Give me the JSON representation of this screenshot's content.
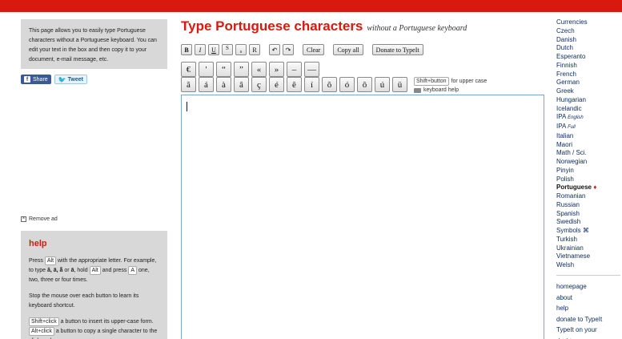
{
  "intro": {
    "text": "This page allows you to easily type Portuguese characters without a Portuguese keyboard. You can edit your text in the box and then copy it to your document, e-mail message, etc."
  },
  "share": {
    "facebook_label": "Share",
    "twitter_label": "Tweet"
  },
  "remove_ad": "Remove ad",
  "help": {
    "heading": "help",
    "p1_a": "Press",
    "p1_alt": "Alt",
    "p1_b": "with the appropriate letter. For example, to type",
    "p1_chars": "ǎ, ā, ā̃",
    "p1_or": "or",
    "p1_char_last": "ā",
    "p1_c": ", hold",
    "p1_alt2": "Alt",
    "p1_d": "and press",
    "p1_a_key": "A",
    "p1_e": "one, two, three or four times.",
    "p2": "Stop the mouse over each button to learn its keyboard shortcut.",
    "p3_shift": "Shift+click",
    "p3_a": "a button to insert its upper-case form.",
    "p3_alt": "Alt+click",
    "p3_b": "a button to copy a single character to the clipboard."
  },
  "header": {
    "title": "Type Portuguese characters",
    "subtitle": "without a Portuguese keyboard"
  },
  "format_buttons": [
    "B",
    "I",
    "U",
    "S",
    "s",
    "R"
  ],
  "undo_redo": [
    "↶",
    "↷"
  ],
  "actions": {
    "clear": "Clear",
    "copy_all": "Copy all",
    "donate": "Donate to TypeIt"
  },
  "symbols": [
    "€",
    "'",
    "“",
    "”",
    "«",
    "»",
    "–",
    "—"
  ],
  "characters": [
    "ã",
    "á",
    "à",
    "â",
    "ç",
    "é",
    "ê",
    "í",
    "õ",
    "ó",
    "ô",
    "ú",
    "ü"
  ],
  "shift_info": {
    "key": "Shift+button",
    "text": "for upper case",
    "kb_help": "keyboard help"
  },
  "editor": {
    "value": ""
  },
  "languages": [
    "Currencies",
    "Czech",
    "Danish",
    "Dutch",
    "Esperanto",
    "Finnish",
    "French",
    "German",
    "Greek",
    "Hungarian",
    "Icelandic",
    "IPA",
    "IPA",
    "Italian",
    "Maori",
    "Math / Sci.",
    "Norwegian",
    "Pinyin",
    "Polish",
    "Portuguese",
    "Romanian",
    "Russian",
    "Spanish",
    "Swedish",
    "Symbols ⌘",
    "Turkish",
    "Ukrainian",
    "Vietnamese",
    "Welsh"
  ],
  "language_suffixes": {
    "ipa_english": "English",
    "ipa_full": "Full",
    "portuguese_mark": "♦"
  },
  "site_links": [
    "homepage",
    "about",
    "help",
    "donate to TypeIt",
    "TypeIt on your desktop"
  ],
  "colors": {
    "brand_red": "#d9190e",
    "panel_gray": "#d8d8d8",
    "link_blue": "#0a2a5e"
  }
}
